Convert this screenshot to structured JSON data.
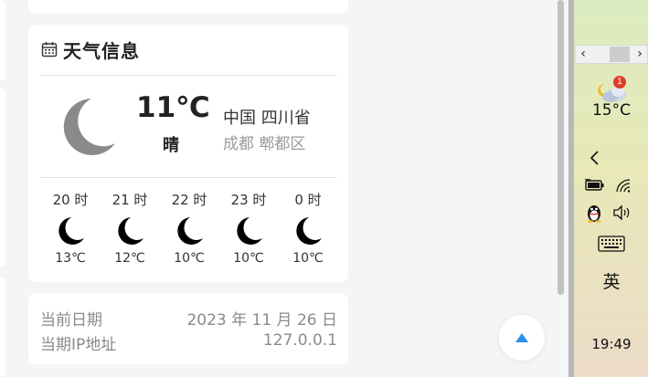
{
  "weather": {
    "title": "天气信息",
    "current_temp": "11℃",
    "current_condition": "晴",
    "location_main": "中国 四川省",
    "location_sub": "成都 郫都区",
    "hourly": [
      {
        "time": "20 时",
        "temp": "13℃",
        "icon": "moon-icon"
      },
      {
        "time": "21 时",
        "temp": "12℃",
        "icon": "moon-icon"
      },
      {
        "time": "22 时",
        "temp": "10℃",
        "icon": "moon-icon"
      },
      {
        "time": "23 时",
        "temp": "10℃",
        "icon": "moon-icon"
      },
      {
        "time": "0 时",
        "temp": "10℃",
        "icon": "moon-icon"
      }
    ]
  },
  "info": {
    "date_label": "当前日期",
    "date_value": "2023 年 11 月 26 日",
    "ip_label": "当期IP地址",
    "ip_value": "127.0.0.1"
  },
  "taskbar": {
    "weather_badge": "1",
    "weather_temp": "15°C",
    "language": "英",
    "time": "19:49"
  },
  "icons": {
    "calendar": "calendar-icon",
    "back_to_top": "arrow-up-icon",
    "tray": [
      "weather-cloud-icon",
      "chevron-left-icon",
      "battery-icon",
      "wifi-icon",
      "qq-penguin-icon",
      "volume-icon",
      "keyboard-icon"
    ]
  },
  "colors": {
    "accent": "#2e8ef0",
    "badge": "#e23c2a",
    "moon_gray": "#8a8a8a"
  }
}
